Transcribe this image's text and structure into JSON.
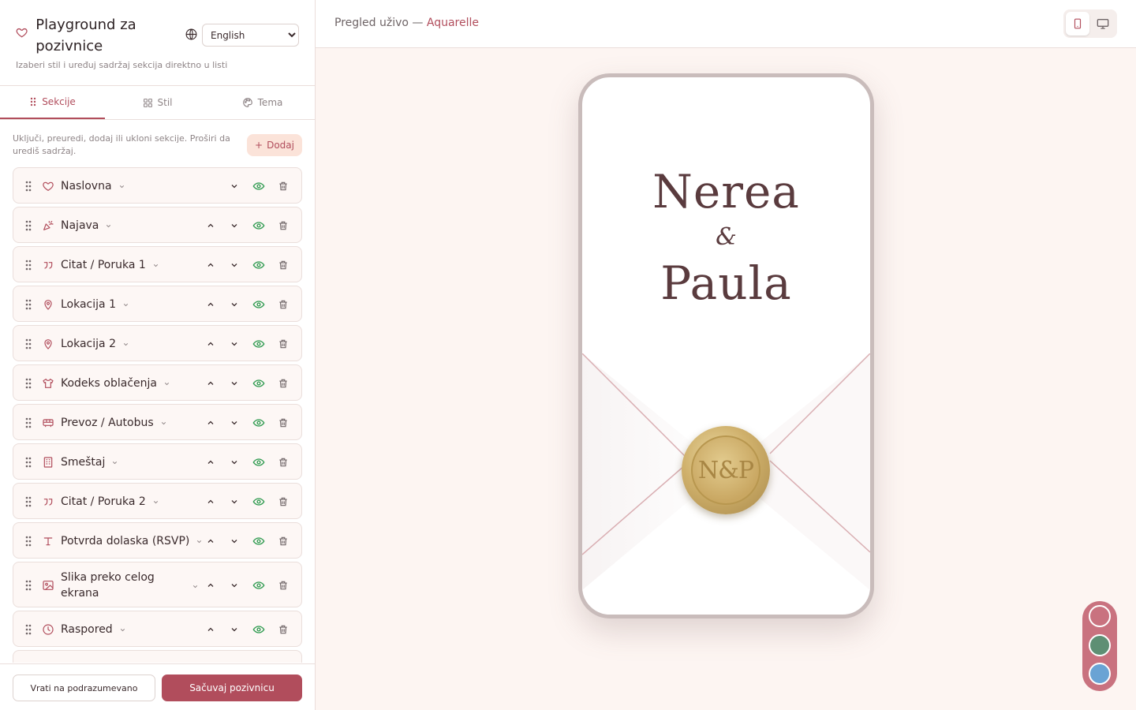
{
  "app": {
    "title": "Playground za pozivnice",
    "subtitle": "Izaberi stil i uređuj sadržaj sekcija direktno u listi",
    "language": {
      "selected": "English",
      "options": [
        "English"
      ]
    }
  },
  "tabs": [
    {
      "label": "Sekcije",
      "icon": "drag-dots-icon",
      "active": true
    },
    {
      "label": "Stil",
      "icon": "grid-icon",
      "active": false
    },
    {
      "label": "Tema",
      "icon": "palette-icon",
      "active": false
    }
  ],
  "sections_panel": {
    "intro": "Uključi, preuredi, dodaj ili ukloni sekcije. Proširi da urediš sadržaj.",
    "add_label": "Dodaj",
    "items": [
      {
        "label": "Naslovna",
        "icon": "heart-icon",
        "has_up": false
      },
      {
        "label": "Najava",
        "icon": "party-popper-icon",
        "has_up": true
      },
      {
        "label": "Citat / Poruka 1",
        "icon": "quote-icon",
        "has_up": true
      },
      {
        "label": "Lokacija 1",
        "icon": "map-pin-icon",
        "has_up": true
      },
      {
        "label": "Lokacija 2",
        "icon": "map-pin-icon",
        "has_up": true
      },
      {
        "label": "Kodeks oblačenja",
        "icon": "shirt-icon",
        "has_up": true
      },
      {
        "label": "Prevoz / Autobus",
        "icon": "bus-icon",
        "has_up": true
      },
      {
        "label": "Smeštaj",
        "icon": "building-icon",
        "has_up": true
      },
      {
        "label": "Citat / Poruka 2",
        "icon": "quote-icon",
        "has_up": true
      },
      {
        "label": "Potvrda dolaska (RSVP)",
        "icon": "text-icon",
        "has_up": true
      },
      {
        "label": "Slika preko celog ekrana",
        "icon": "image-icon",
        "has_up": true
      },
      {
        "label": "Raspored",
        "icon": "clock-icon",
        "has_up": true
      }
    ]
  },
  "footer": {
    "reset_label": "Vrati na podrazumevano",
    "save_label": "Sačuvaj pozivnicu"
  },
  "preview": {
    "label": "Pregled uživo —",
    "theme": "Aquarelle",
    "device": "mobile"
  },
  "invitation": {
    "name1": "Nerea",
    "ampersand": "&",
    "name2": "Paula",
    "monogram": "N&P"
  },
  "colors": {
    "accent": "#b14d5c",
    "swatches": [
      "#c9727f",
      "#5e8f74",
      "#6aa3d4"
    ]
  }
}
